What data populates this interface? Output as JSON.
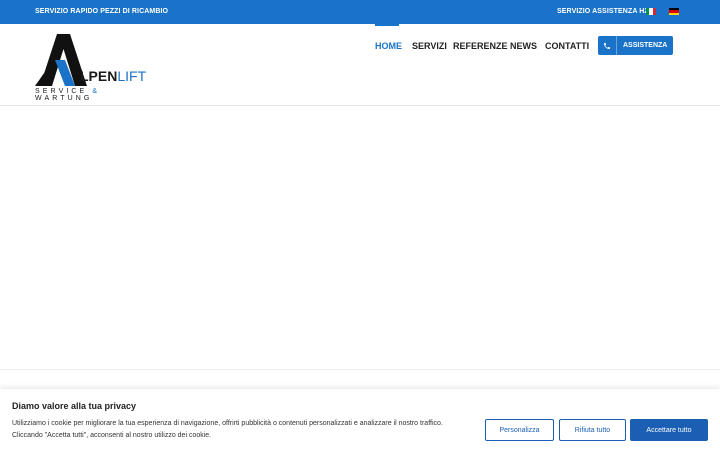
{
  "topbar": {
    "left_link": "SERVIZIO RAPIDO PEZZI DI RICAMBIO",
    "right_link": "SERVIZIO ASSISTENZA H24",
    "flags": [
      "italian-flag-icon",
      "german-flag-icon"
    ]
  },
  "logo": {
    "word_main": "LPEN",
    "word_accent": "LIFT",
    "sub_main": "SERVICE ",
    "sub_amp": "&",
    "sub_end": " WARTUNG"
  },
  "nav": {
    "items": [
      {
        "label": "HOME",
        "active": true
      },
      {
        "label": "SERVIZI",
        "active": false
      },
      {
        "label": "REFERENZE",
        "active": false
      },
      {
        "label": "NEWS",
        "active": false
      },
      {
        "label": "CONTATTI",
        "active": false
      }
    ],
    "assist_button": "ASSISTENZA",
    "assist_icon": "phone-icon"
  },
  "cookie": {
    "title": "Diamo valore alla tua privacy",
    "text_line1": "Utilizziamo i cookie per migliorare la tua esperienza di navigazione, offrirti pubblicità o contenuti personalizzati e analizzare il nostro traffico.",
    "text_line2": "Cliccando \"Accetta tutti\", acconsenti al nostro utilizzo dei cookie.",
    "customize_label": "Personalizza",
    "reject_label": "Rifiuta tutto",
    "accept_label": "Accettare tutto"
  },
  "colors": {
    "brand_blue": "#1a73c8",
    "button_blue": "#1a5fb4",
    "text_dark": "#222222"
  }
}
